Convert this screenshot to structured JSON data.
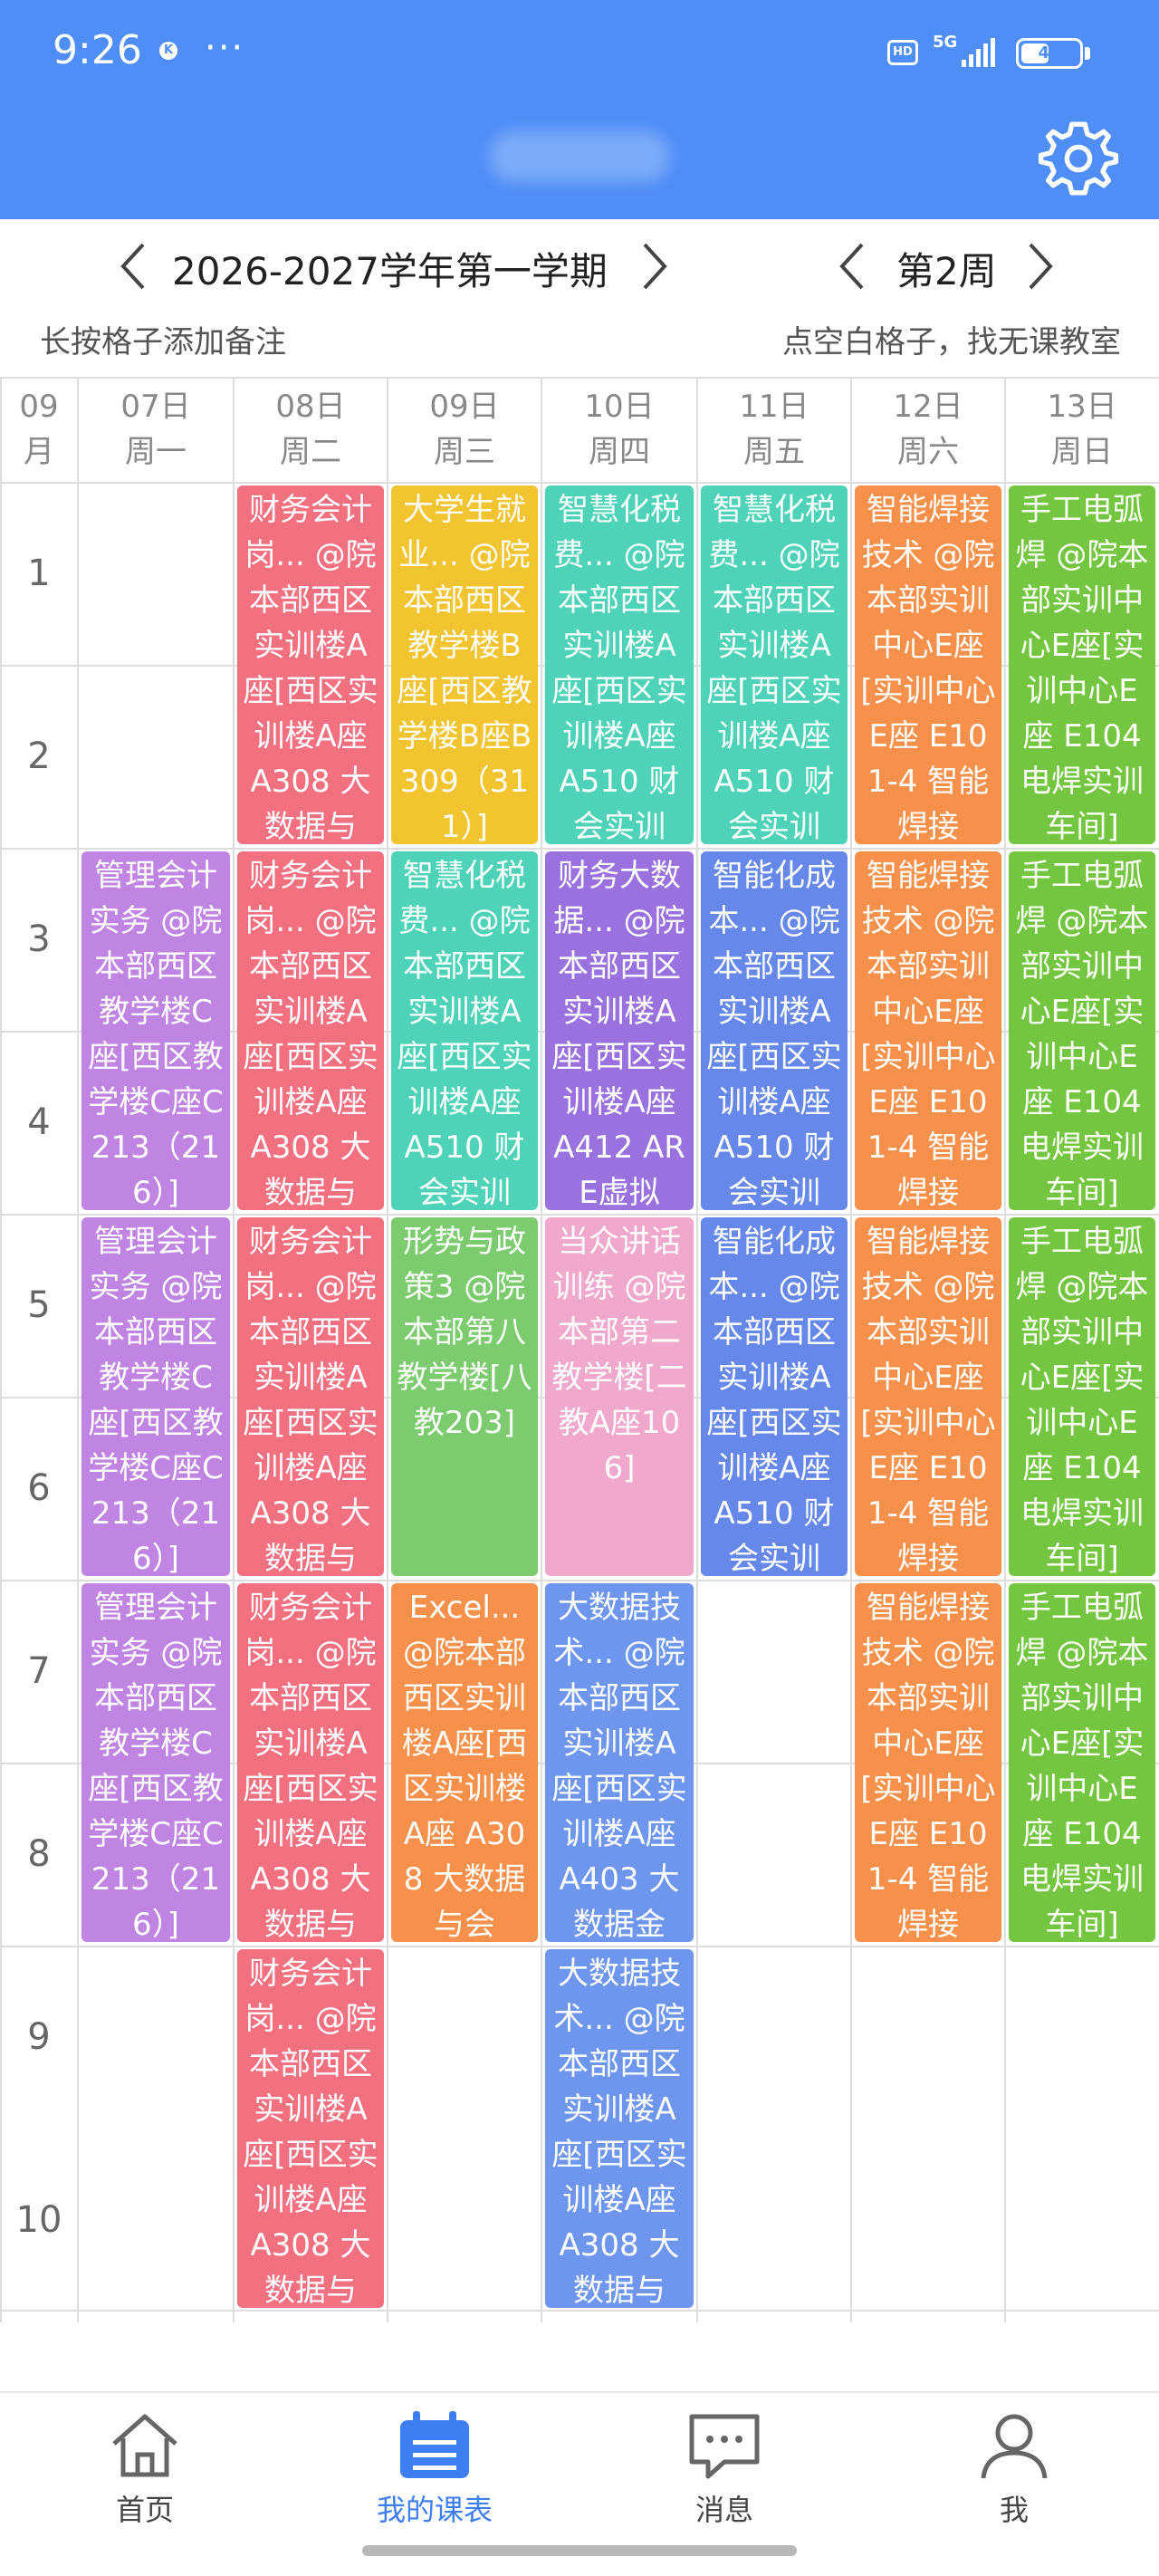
{
  "status": {
    "time": "9:26",
    "network": "5G",
    "hd": "HD",
    "battery": 49,
    "k_icon": "K",
    "more": "···"
  },
  "header": {
    "settings_icon": "gear-icon"
  },
  "nav": {
    "semester": "2026-2027学年第一学期",
    "week": "第2周",
    "hint_left": "长按格子添加备注",
    "hint_right": "点空白格子，找无课教室"
  },
  "grid": {
    "month_top": "09",
    "month_bottom": "月",
    "days": [
      {
        "date": "07日",
        "weekday": "周一"
      },
      {
        "date": "08日",
        "weekday": "周二"
      },
      {
        "date": "09日",
        "weekday": "周三"
      },
      {
        "date": "10日",
        "weekday": "周四"
      },
      {
        "date": "11日",
        "weekday": "周五"
      },
      {
        "date": "12日",
        "weekday": "周六"
      },
      {
        "date": "13日",
        "weekday": "周日"
      }
    ],
    "periods": [
      "1",
      "2",
      "3",
      "4",
      "5",
      "6",
      "7",
      "8",
      "9",
      "10"
    ]
  },
  "courses": [
    {
      "day": 1,
      "start": 1,
      "span": 2,
      "color": "#f2707f",
      "text": "财务会计岗... @院本部西区实训楼A座[西区实训楼A座 A308 大数据与"
    },
    {
      "day": 2,
      "start": 1,
      "span": 2,
      "color": "#f1c430",
      "text": "大学生就业... @院本部西区教学楼B座[西区教学楼B座B309（311）]"
    },
    {
      "day": 3,
      "start": 1,
      "span": 2,
      "color": "#4fd3b8",
      "text": "智慧化税费... @院本部西区实训楼A座[西区实训楼A座 A510 财会实训"
    },
    {
      "day": 4,
      "start": 1,
      "span": 2,
      "color": "#4fd3b8",
      "text": "智慧化税费... @院本部西区实训楼A座[西区实训楼A座 A510 财会实训"
    },
    {
      "day": 5,
      "start": 1,
      "span": 2,
      "color": "#f7904a",
      "text": "智能焊接技术 @院本部实训中心E座[实训中心E座 E101-4 智能焊接"
    },
    {
      "day": 6,
      "start": 1,
      "span": 2,
      "color": "#74c53f",
      "text": "手工电弧焊 @院本部实训中心E座[实训中心E座 E104 电焊实训车间]"
    },
    {
      "day": 0,
      "start": 3,
      "span": 2,
      "color": "#c084e3",
      "text": "管理会计实务 @院本部西区教学楼C座[西区教学楼C座C213（216）]"
    },
    {
      "day": 1,
      "start": 3,
      "span": 2,
      "color": "#f2707f",
      "text": "财务会计岗... @院本部西区实训楼A座[西区实训楼A座 A308 大数据与"
    },
    {
      "day": 2,
      "start": 3,
      "span": 2,
      "color": "#4fd3b8",
      "text": "智慧化税费... @院本部西区实训楼A座[西区实训楼A座 A510 财会实训"
    },
    {
      "day": 3,
      "start": 3,
      "span": 2,
      "color": "#9a72e0",
      "text": "财务大数据... @院本部西区实训楼A座[西区实训楼A座 A412 ARE虚拟"
    },
    {
      "day": 4,
      "start": 3,
      "span": 2,
      "color": "#6688ea",
      "text": "智能化成本... @院本部西区实训楼A座[西区实训楼A座 A510 财会实训"
    },
    {
      "day": 5,
      "start": 3,
      "span": 2,
      "color": "#f7904a",
      "text": "智能焊接技术 @院本部实训中心E座[实训中心E座 E101-4 智能焊接"
    },
    {
      "day": 6,
      "start": 3,
      "span": 2,
      "color": "#74c53f",
      "text": "手工电弧焊 @院本部实训中心E座[实训中心E座 E104 电焊实训车间]"
    },
    {
      "day": 0,
      "start": 5,
      "span": 2,
      "color": "#c084e3",
      "text": "管理会计实务 @院本部西区教学楼C座[西区教学楼C座C213（216）]"
    },
    {
      "day": 1,
      "start": 5,
      "span": 2,
      "color": "#f2707f",
      "text": "财务会计岗... @院本部西区实训楼A座[西区实训楼A座 A308 大数据与"
    },
    {
      "day": 2,
      "start": 5,
      "span": 2,
      "color": "#7ccb6e",
      "text": "形势与政策3 @院本部第八教学楼[八教203]"
    },
    {
      "day": 3,
      "start": 5,
      "span": 2,
      "color": "#f0a8cc",
      "text": "当众讲话训练 @院本部第二教学楼[二教A座106]"
    },
    {
      "day": 4,
      "start": 5,
      "span": 2,
      "color": "#6688ea",
      "text": "智能化成本... @院本部西区实训楼A座[西区实训楼A座 A510 财会实训"
    },
    {
      "day": 5,
      "start": 5,
      "span": 2,
      "color": "#f7904a",
      "text": "智能焊接技术 @院本部实训中心E座[实训中心E座 E101-4 智能焊接"
    },
    {
      "day": 6,
      "start": 5,
      "span": 2,
      "color": "#74c53f",
      "text": "手工电弧焊 @院本部实训中心E座[实训中心E座 E104 电焊实训车间]"
    },
    {
      "day": 0,
      "start": 7,
      "span": 2,
      "color": "#c084e3",
      "text": "管理会计实务 @院本部西区教学楼C座[西区教学楼C座C213（216）]"
    },
    {
      "day": 1,
      "start": 7,
      "span": 2,
      "color": "#f2707f",
      "text": "财务会计岗... @院本部西区实训楼A座[西区实训楼A座 A308 大数据与"
    },
    {
      "day": 2,
      "start": 7,
      "span": 2,
      "color": "#f7904a",
      "text": "Excel... @院本部西区实训楼A座[西区实训楼A座 A308 大数据与会"
    },
    {
      "day": 3,
      "start": 7,
      "span": 2,
      "color": "#6f96ee",
      "text": "大数据技术... @院本部西区实训楼A座[西区实训楼A座 A403 大数据金"
    },
    {
      "day": 5,
      "start": 7,
      "span": 2,
      "color": "#f7904a",
      "text": "智能焊接技术 @院本部实训中心E座[实训中心E座 E101-4 智能焊接"
    },
    {
      "day": 6,
      "start": 7,
      "span": 2,
      "color": "#74c53f",
      "text": "手工电弧焊 @院本部实训中心E座[实训中心E座 E104 电焊实训车间]"
    },
    {
      "day": 1,
      "start": 9,
      "span": 2,
      "color": "#f2707f",
      "text": "财务会计岗... @院本部西区实训楼A座[西区实训楼A座 A308 大数据与"
    },
    {
      "day": 3,
      "start": 9,
      "span": 2,
      "color": "#6f96ee",
      "text": "大数据技术... @院本部西区实训楼A座[西区实训楼A座 A308 大数据与"
    }
  ],
  "bottom_nav": [
    {
      "label": "首页",
      "icon": "home-icon",
      "active": false
    },
    {
      "label": "我的课表",
      "icon": "calendar-icon",
      "active": true
    },
    {
      "label": "消息",
      "icon": "message-icon",
      "active": false
    },
    {
      "label": "我",
      "icon": "user-icon",
      "active": false
    }
  ],
  "colors": {
    "primary": "#4f8ef7",
    "active_tab": "#3d7ef2"
  }
}
